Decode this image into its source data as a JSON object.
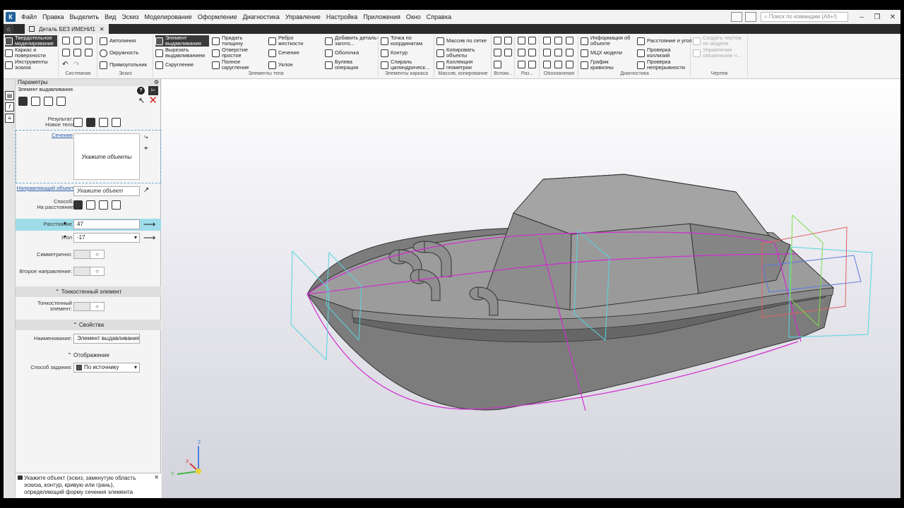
{
  "menu": [
    "Файл",
    "Правка",
    "Выделить",
    "Вид",
    "Эскиз",
    "Моделирование",
    "Оформление",
    "Диагностика",
    "Управление",
    "Настройка",
    "Приложения",
    "Окно",
    "Справка"
  ],
  "search_placeholder": "Поиск по командам (Alt+/)",
  "tab": {
    "label": "Деталь БЕЗ ИМЕНИ1",
    "close": "✕"
  },
  "ribbon": {
    "modes": [
      "Твердотельное моделирование",
      "Каркас и поверхности",
      "Инструменты эскиза"
    ],
    "groups": {
      "system": "Системная",
      "sketch": "Эскиз",
      "body": "Элементы тела",
      "frame": "Элементы каркаса",
      "array": "Массив, копирование",
      "aux": "Вспом...",
      "dim": "Раз...",
      "marks": "Обозначения",
      "diag": "Диагностика",
      "drawing": "Чертеж"
    },
    "sketch_items": [
      "Автолиния",
      "Окружность",
      "Прямоугольник"
    ],
    "body_items": [
      "Элемент выдавливания",
      "Вырезать выдавливанием",
      "Скругление",
      "Придать толщину",
      "Отверстие простое",
      "Полное скругление",
      "Ребро жесткости",
      "Сечение",
      "Уклон",
      "Добавить деталь-загото...",
      "Оболочка",
      "Булева операция"
    ],
    "frame_items": [
      "Точка по координатам",
      "Контур",
      "Спираль цилиндрическ..."
    ],
    "array_items": [
      "Массив по сетке",
      "Копировать объекты",
      "Коллекция геометрии"
    ],
    "diag_items": [
      "Информация об объекте",
      "МЦХ модели",
      "График кривизны",
      "Расстояние и угол",
      "Проверка коллизий",
      "Проверка непрерывности"
    ],
    "drawing_items": [
      "Создать чертеж по модели",
      "Управление связанными ч..."
    ]
  },
  "params": {
    "panel_title": "Параметры",
    "op_title": "Элемент выдавливания",
    "result_label": "Результат:",
    "result_value": "Новое тело",
    "section_label": "Сечение",
    "section_hint": "Укажите объекты",
    "direction_label": "Направляющий объект",
    "direction_hint": "Укажите объект",
    "method_label": "Способ:",
    "method_value": "На расстояние",
    "distance_label": "Расстояние",
    "distance_value": "47",
    "angle_label": "Угол",
    "angle_value": "-17",
    "symmetric_label": "Симметрично:",
    "second_dir_label": "Второе направление:",
    "thin_section": "Тонкостенный элемент",
    "thin_label": "Тонкостенный элемент:",
    "props_section": "Свойства",
    "name_label": "Наименование:",
    "name_value": "Элемент выдавливания",
    "display_section": "Отображение",
    "display_label": "Способ задания:",
    "display_value": "По источнику",
    "status_text": "Укажите объект (эскиз, замкнутую область эскиза, контур, кривую или грань), определяющий форму сечения элемента"
  },
  "axes": {
    "x": "X",
    "y": "Y",
    "z": "Z"
  }
}
